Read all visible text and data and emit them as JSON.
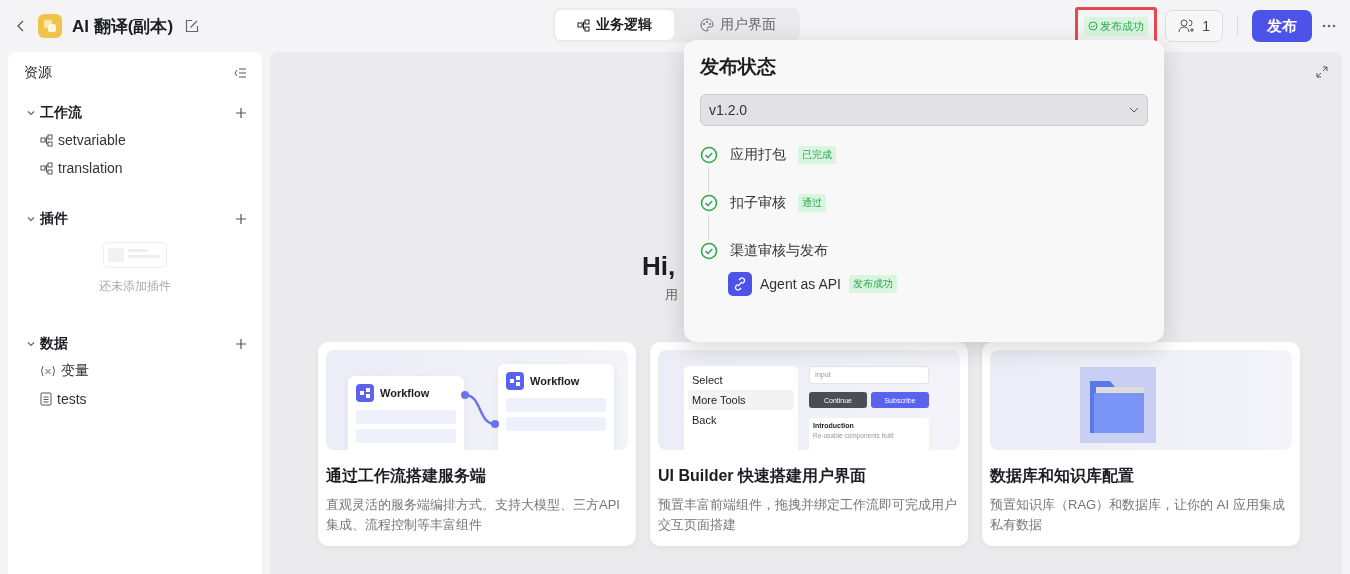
{
  "header": {
    "title": "AI 翻译(副本)",
    "tabs": [
      {
        "label": "业务逻辑",
        "kind": "workflow",
        "selected": true
      },
      {
        "label": "用户界面",
        "kind": "palette",
        "selected": false
      }
    ],
    "status": "发布成功",
    "collaborators": "1",
    "publish": "发布"
  },
  "sidebar": {
    "title": "资源",
    "sections": [
      {
        "title": "工作流",
        "expanded": true,
        "items": [
          {
            "kind": "workflow",
            "label": "setvariable"
          },
          {
            "kind": "workflow",
            "label": "translation"
          }
        ]
      },
      {
        "title": "插件",
        "expanded": true,
        "empty": "还未添加插件"
      },
      {
        "title": "数据",
        "expanded": true,
        "items": [
          {
            "kind": "variable",
            "label": "变量"
          },
          {
            "kind": "table",
            "label": "tests"
          }
        ]
      }
    ]
  },
  "hero": {
    "title": "Hi,",
    "subtitle": "用"
  },
  "popover": {
    "title": "发布状态",
    "version": "v1.2.0",
    "steps": [
      {
        "label": "应用打包",
        "tag": "已完成",
        "done": true
      },
      {
        "label": "扣子审核",
        "tag": "通过",
        "done": true
      },
      {
        "label": "渠道审核与发布",
        "done": true,
        "channels": [
          {
            "name": "Agent as API",
            "tag": "发布成功"
          }
        ]
      }
    ]
  },
  "cards": [
    {
      "kind": "workflow",
      "title": "通过工作流搭建服务端",
      "description": "直观灵活的服务端编排方式。支持大模型、三方API集成、流程控制等丰富组件",
      "nodes": [
        "Workflow",
        "Workflow"
      ]
    },
    {
      "kind": "ui",
      "title": "UI Builder 快速搭建用户界面",
      "description": "预置丰富前端组件，拖拽并绑定工作流即可完成用户交互页面搭建",
      "menu": [
        "Select",
        "More Tools",
        "Back"
      ],
      "input": "Input",
      "buttons": [
        "Continue",
        "Subscribe"
      ],
      "note_title": "Introduction",
      "note_text": "Re-usable components built"
    },
    {
      "kind": "data",
      "title": "数据库和知识库配置",
      "description": "预置知识库（RAG）和数据库，让你的 AI 应用集成私有数据"
    }
  ]
}
